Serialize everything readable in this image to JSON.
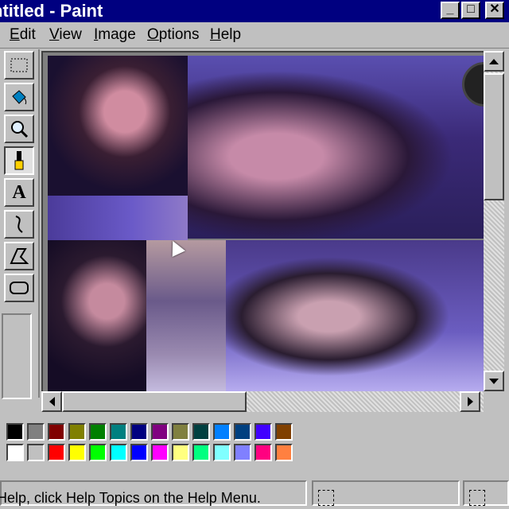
{
  "window": {
    "title": "ntitled - Paint",
    "buttons": {
      "minimize_icon": "minimize-icon",
      "maximize_icon": "maximize-icon",
      "close_icon": "close-icon"
    }
  },
  "menu": {
    "items": [
      {
        "accel": "E",
        "rest": "dit"
      },
      {
        "accel": "V",
        "rest": "iew"
      },
      {
        "accel": "I",
        "rest": "mage"
      },
      {
        "accel": "O",
        "rest": "ptions"
      },
      {
        "accel": "H",
        "rest": "elp"
      }
    ]
  },
  "toolbox": {
    "tools": [
      {
        "icon": "select-rectangle-icon",
        "active": false
      },
      {
        "icon": "fill-bucket-icon",
        "active": false
      },
      {
        "icon": "magnifier-icon",
        "active": false
      },
      {
        "icon": "brush-icon",
        "active": true
      },
      {
        "icon": "text-icon",
        "active": false
      },
      {
        "icon": "curve-icon",
        "active": false
      },
      {
        "icon": "polygon-icon",
        "active": false
      },
      {
        "icon": "rounded-rectangle-icon",
        "active": false
      }
    ]
  },
  "palette": {
    "row1": [
      "#000000",
      "#808080",
      "#800000",
      "#808000",
      "#008000",
      "#008080",
      "#000080",
      "#800080",
      "#808040",
      "#004040",
      "#0080ff",
      "#004080",
      "#4000ff",
      "#804000"
    ],
    "row2": [
      "#ffffff",
      "#c0c0c0",
      "#ff0000",
      "#ffff00",
      "#00ff00",
      "#00ffff",
      "#0000ff",
      "#ff00ff",
      "#ffff80",
      "#00ff80",
      "#80ffff",
      "#8080ff",
      "#ff0080",
      "#ff8040"
    ]
  },
  "status": {
    "help_text": "Help, click Help Topics on the Help Menu."
  }
}
